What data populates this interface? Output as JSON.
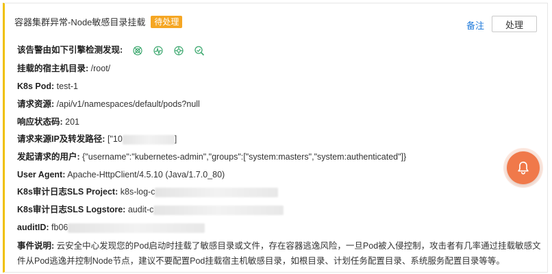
{
  "header": {
    "title": "容器集群异常-Node敏感目录挂载",
    "status_badge": "待处理",
    "note_label": "备注",
    "handle_label": "处理"
  },
  "engines": {
    "label": "该告警由如下引擎检测发现:",
    "icons": [
      "engine-a-icon",
      "engine-b-icon",
      "engine-c-icon",
      "engine-d-icon"
    ],
    "icon_color": "#3aa76d"
  },
  "fields": {
    "mount_dir": {
      "label": "挂载的宿主机目录:",
      "value": "/root/"
    },
    "pod": {
      "label": "K8s Pod:",
      "value": "test-1"
    },
    "resource": {
      "label": "请求资源:",
      "value": "/api/v1/namespaces/default/pods?null"
    },
    "status_code": {
      "label": "响应状态码:",
      "value": "201"
    },
    "source_ip": {
      "label": "请求来源IP及转发路径:",
      "value_prefix": "[\"10",
      "value_suffix": "]"
    },
    "user": {
      "label": "发起请求的用户:",
      "value": "{\"username\":\"kubernetes-admin\",\"groups\":[\"system:masters\",\"system:authenticated\"]}"
    },
    "user_agent": {
      "label": "User Agent:",
      "value": "Apache-HttpClient/4.5.10 (Java/1.7.0_80)"
    },
    "sls_project": {
      "label": "K8s审计日志SLS Project:",
      "value_prefix": "k8s-log-c"
    },
    "sls_logstore": {
      "label": "K8s审计日志SLS Logstore:",
      "value_prefix": "audit-c"
    },
    "audit_id": {
      "label": "auditID:",
      "value_prefix": "fb06"
    }
  },
  "description": {
    "label": "事件说明:",
    "text": "云安全中心发现您的Pod启动时挂载了敏感目录或文件，存在容器逃逸风险，一旦Pod被入侵控制，攻击者有几率通过挂载敏感文件从Pod逃逸并控制Node节点，建议不要配置Pod挂载宿主机敏感目录，如根目录、计划任务配置目录、系统服务配置目录等等。"
  },
  "floating": {
    "icon": "bell-icon",
    "color": "#f0794a"
  },
  "colors": {
    "accent_border": "#f0c000",
    "badge": "#f5a623",
    "link": "#1f7adb"
  }
}
